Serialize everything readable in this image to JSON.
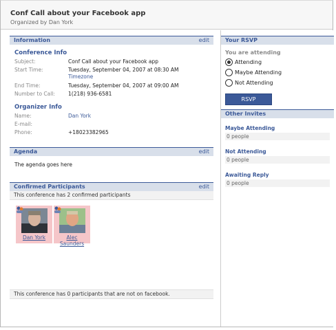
{
  "header": {
    "title": "Conf Call about your Facebook app",
    "organizer": "Organized by Dan York"
  },
  "information": {
    "bar_title": "Information",
    "edit_label": "edit",
    "conference_heading": "Conference Info",
    "subject_label": "Subject:",
    "subject_value": "Conf Call about your Facebook app",
    "start_label": "Start Time:",
    "start_value": "Tuesday, September 04, 2007 at 08:30 AM",
    "timezone_link": "Timezone",
    "end_label": "End Time:",
    "end_value": "Tuesday, September 04, 2007 at 09:00 AM",
    "number_label": "Number to Call:",
    "number_value": "1(218) 936-6581",
    "organizer_heading": "Organizer Info",
    "name_label": "Name:",
    "name_value": "Dan York",
    "email_label": "E-mail:",
    "email_value": "",
    "phone_label": "Phone:",
    "phone_value": "+18023382965"
  },
  "agenda": {
    "bar_title": "Agenda",
    "edit_label": "edit",
    "text": "The agenda goes here"
  },
  "participants": {
    "bar_title": "Confirmed Participants",
    "edit_label": "edit",
    "summary": "This conference has 2 confirmed participants",
    "people": [
      {
        "name": "Dan York"
      },
      {
        "name": "Alec Saunders"
      }
    ],
    "footer": "This conference has 0 participants that are not on facebook."
  },
  "rsvp": {
    "bar_title": "Your RSVP",
    "status": "You are attending",
    "options": [
      "Attending",
      "Maybe Attending",
      "Not Attending"
    ],
    "selected": "Attending",
    "button_label": "RSVP"
  },
  "invites": {
    "bar_title": "Other Invites",
    "groups": [
      {
        "label": "Maybe Attending",
        "count": "0 people"
      },
      {
        "label": "Not Attending",
        "count": "0 people"
      },
      {
        "label": "Awaiting Reply",
        "count": "0 people"
      }
    ]
  },
  "colors": {
    "brand": "#3b5998",
    "bar_bg": "#d8dfea",
    "photo_bg": "#f5c6c9"
  }
}
